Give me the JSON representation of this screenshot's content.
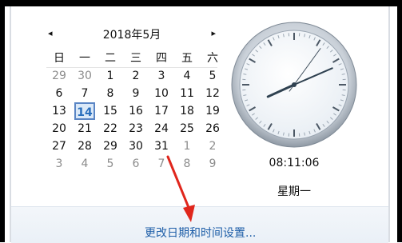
{
  "calendar": {
    "title": "2018年5月",
    "prev_icon": "◂",
    "next_icon": "▸",
    "weekdays": [
      "日",
      "一",
      "二",
      "三",
      "四",
      "五",
      "六"
    ],
    "weeks": [
      [
        {
          "d": "29",
          "m": true
        },
        {
          "d": "30",
          "m": true
        },
        {
          "d": "1"
        },
        {
          "d": "2"
        },
        {
          "d": "3"
        },
        {
          "d": "4"
        },
        {
          "d": "5"
        }
      ],
      [
        {
          "d": "6"
        },
        {
          "d": "7"
        },
        {
          "d": "8"
        },
        {
          "d": "9"
        },
        {
          "d": "10"
        },
        {
          "d": "11"
        },
        {
          "d": "12"
        }
      ],
      [
        {
          "d": "13"
        },
        {
          "d": "14",
          "today": true
        },
        {
          "d": "15"
        },
        {
          "d": "16"
        },
        {
          "d": "17"
        },
        {
          "d": "18"
        },
        {
          "d": "19"
        }
      ],
      [
        {
          "d": "20"
        },
        {
          "d": "21"
        },
        {
          "d": "22"
        },
        {
          "d": "23"
        },
        {
          "d": "24"
        },
        {
          "d": "25"
        },
        {
          "d": "26"
        }
      ],
      [
        {
          "d": "27"
        },
        {
          "d": "28"
        },
        {
          "d": "29"
        },
        {
          "d": "30"
        },
        {
          "d": "31"
        },
        {
          "d": "1",
          "m": true
        },
        {
          "d": "2",
          "m": true
        }
      ],
      [
        {
          "d": "3",
          "m": true
        },
        {
          "d": "4",
          "m": true
        },
        {
          "d": "5",
          "m": true
        },
        {
          "d": "6",
          "m": true
        },
        {
          "d": "7",
          "m": true
        },
        {
          "d": "8",
          "m": true
        },
        {
          "d": "9",
          "m": true
        }
      ]
    ]
  },
  "clock": {
    "time": "08:11:06",
    "weekday": "星期一"
  },
  "footer": {
    "link_label": "更改日期和时间设置..."
  },
  "colors": {
    "link": "#1e5ea8",
    "today_border": "#5b86c5",
    "annotation_arrow": "#e0261c"
  }
}
